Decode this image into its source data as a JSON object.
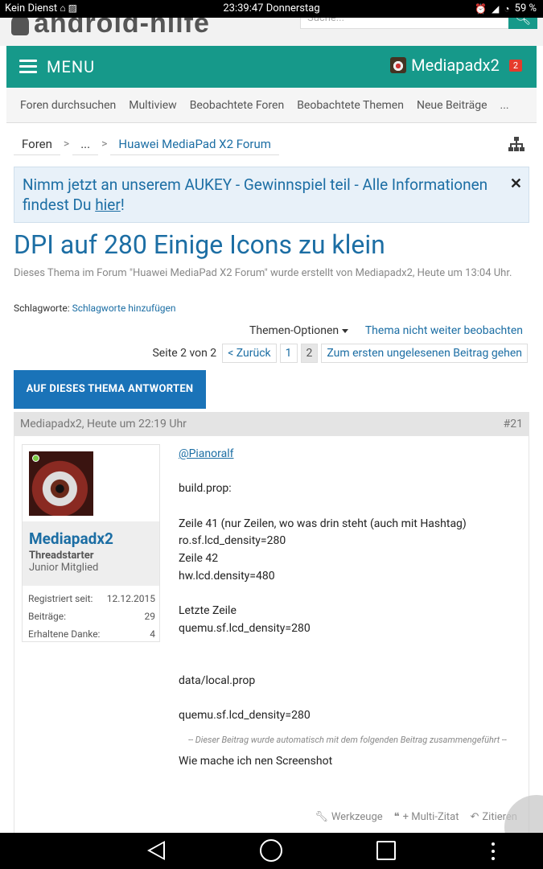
{
  "status_bar": {
    "carrier": "Kein Dienst",
    "time": "23:39:47 Donnerstag",
    "battery": "59 %"
  },
  "header": {
    "logo_text": "android-hilfe",
    "search_placeholder": "Suche...",
    "accent": "#16998a"
  },
  "nav": {
    "menu_label": "MENU",
    "username": "Mediapadx2",
    "notification_count": "2"
  },
  "subnav": {
    "items": [
      "Foren durchsuchen",
      "Multiview",
      "Beobachtete Foren",
      "Beobachtete Themen",
      "Neue Beiträge",
      "..."
    ]
  },
  "breadcrumb": {
    "items": [
      "Foren",
      "...",
      "Huawei MediaPad X2 Forum"
    ]
  },
  "notice": {
    "text_before": "Nimm jetzt an unserem AUKEY - Gewinnspiel teil - Alle Informationen findest Du ",
    "link_text": "hier",
    "text_after": "!"
  },
  "thread": {
    "title": "DPI auf 280 Einige Icons zu klein",
    "description": "Dieses Thema im Forum \"Huawei MediaPad X2 Forum\" wurde erstellt von Mediapadx2, Heute um 13:04 Uhr.",
    "tags_label": "Schlagworte:",
    "tags_link": "Schlagworte hinzufügen",
    "options_label": "Themen-Optionen",
    "unwatch_label": "Thema nicht weiter beobachten",
    "reply_label": "AUF DIESES THEMA ANTWORTEN"
  },
  "pagination": {
    "label": "Seite 2 von 2",
    "prev": "< Zurück",
    "pages": [
      "1",
      "2"
    ],
    "current": "2",
    "first_unread": "Zum ersten ungelesenen Beitrag gehen"
  },
  "post": {
    "author_date": "Mediapadx2, Heute um 22:19 Uhr",
    "number": "#21",
    "user": {
      "name": "Mediapadx2",
      "role": "Threadstarter",
      "rank": "Junior Mitglied",
      "stats": [
        {
          "label": "Registriert seit:",
          "value": "12.12.2015"
        },
        {
          "label": "Beiträge:",
          "value": "29"
        },
        {
          "label": "Erhaltene Danke:",
          "value": "4"
        }
      ]
    },
    "mention": "@Pianoralf",
    "lines": [
      "",
      "build.prop:",
      "",
      "Zeile 41 (nur Zeilen, wo was drin steht (auch mit Hashtag)",
      "ro.sf.lcd_density=280",
      "Zeile 42",
      "hw.lcd.density=480",
      "",
      "Letzte Zeile",
      "quemu.sf.lcd_density=280",
      "",
      "",
      "data/local.prop",
      "",
      "quemu.sf.lcd_density=280"
    ],
    "merged_note": "-- Dieser Beitrag wurde automatisch mit dem folgenden Beitrag zusammengeführt --",
    "last_line": "Wie mache ich nen Screenshot",
    "footer": {
      "tools": "Werkzeuge",
      "multiquote": "+ Multi-Zitat",
      "quote": "Zitieren"
    }
  }
}
